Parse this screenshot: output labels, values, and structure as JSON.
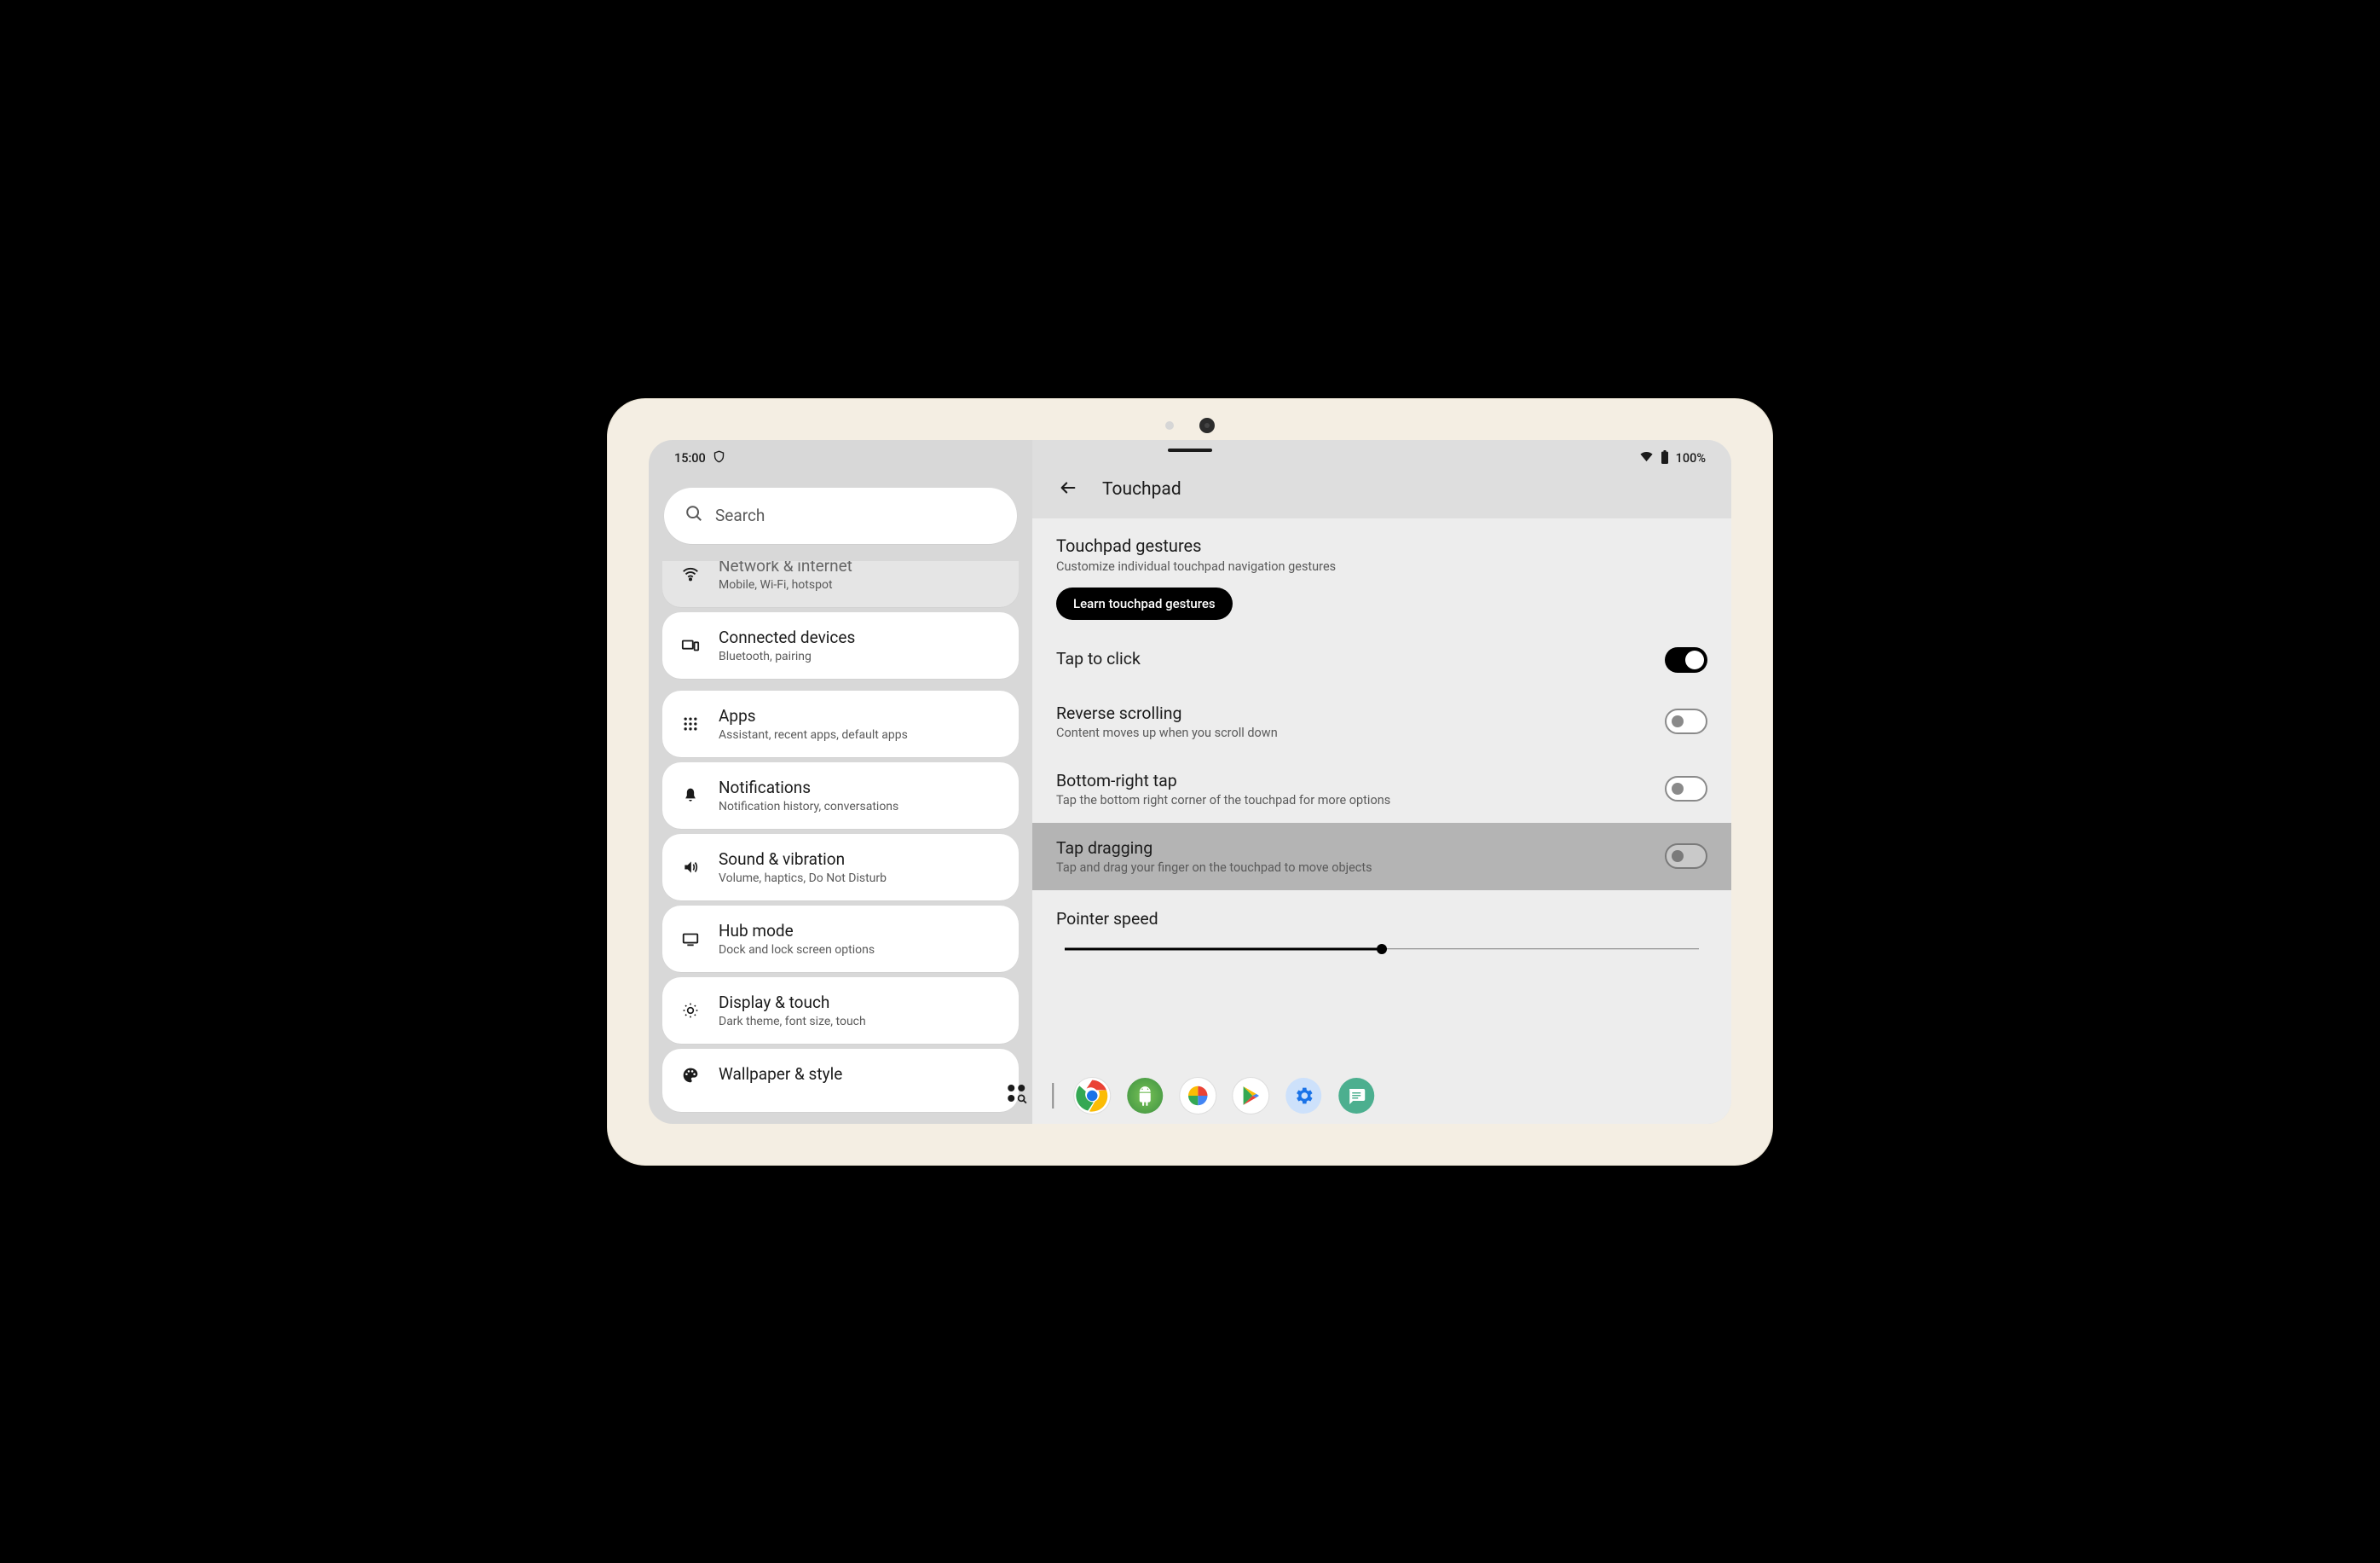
{
  "status": {
    "time": "15:00",
    "battery": "100%"
  },
  "search": {
    "placeholder": "Search"
  },
  "sidebar": {
    "items": [
      {
        "title": "Network & internet",
        "sub": "Mobile, Wi-Fi, hotspot"
      },
      {
        "title": "Connected devices",
        "sub": "Bluetooth, pairing"
      },
      {
        "title": "Apps",
        "sub": "Assistant, recent apps, default apps"
      },
      {
        "title": "Notifications",
        "sub": "Notification history, conversations"
      },
      {
        "title": "Sound & vibration",
        "sub": "Volume, haptics, Do Not Disturb"
      },
      {
        "title": "Hub mode",
        "sub": "Dock and lock screen options"
      },
      {
        "title": "Display & touch",
        "sub": "Dark theme, font size, touch"
      },
      {
        "title": "Wallpaper & style",
        "sub": ""
      }
    ]
  },
  "content": {
    "title": "Touchpad",
    "gestures": {
      "title": "Touchpad gestures",
      "sub": "Customize individual touchpad navigation gestures",
      "learn": "Learn touchpad gestures"
    },
    "rows": [
      {
        "title": "Tap to click",
        "sub": "",
        "on": true
      },
      {
        "title": "Reverse scrolling",
        "sub": "Content moves up when you scroll down",
        "on": false
      },
      {
        "title": "Bottom-right tap",
        "sub": "Tap the bottom right corner of the touchpad for more options",
        "on": false
      },
      {
        "title": "Tap dragging",
        "sub": "Tap and drag your finger on the touchpad to move objects",
        "on": false
      }
    ],
    "pointer": {
      "title": "Pointer speed",
      "value": 50
    }
  }
}
